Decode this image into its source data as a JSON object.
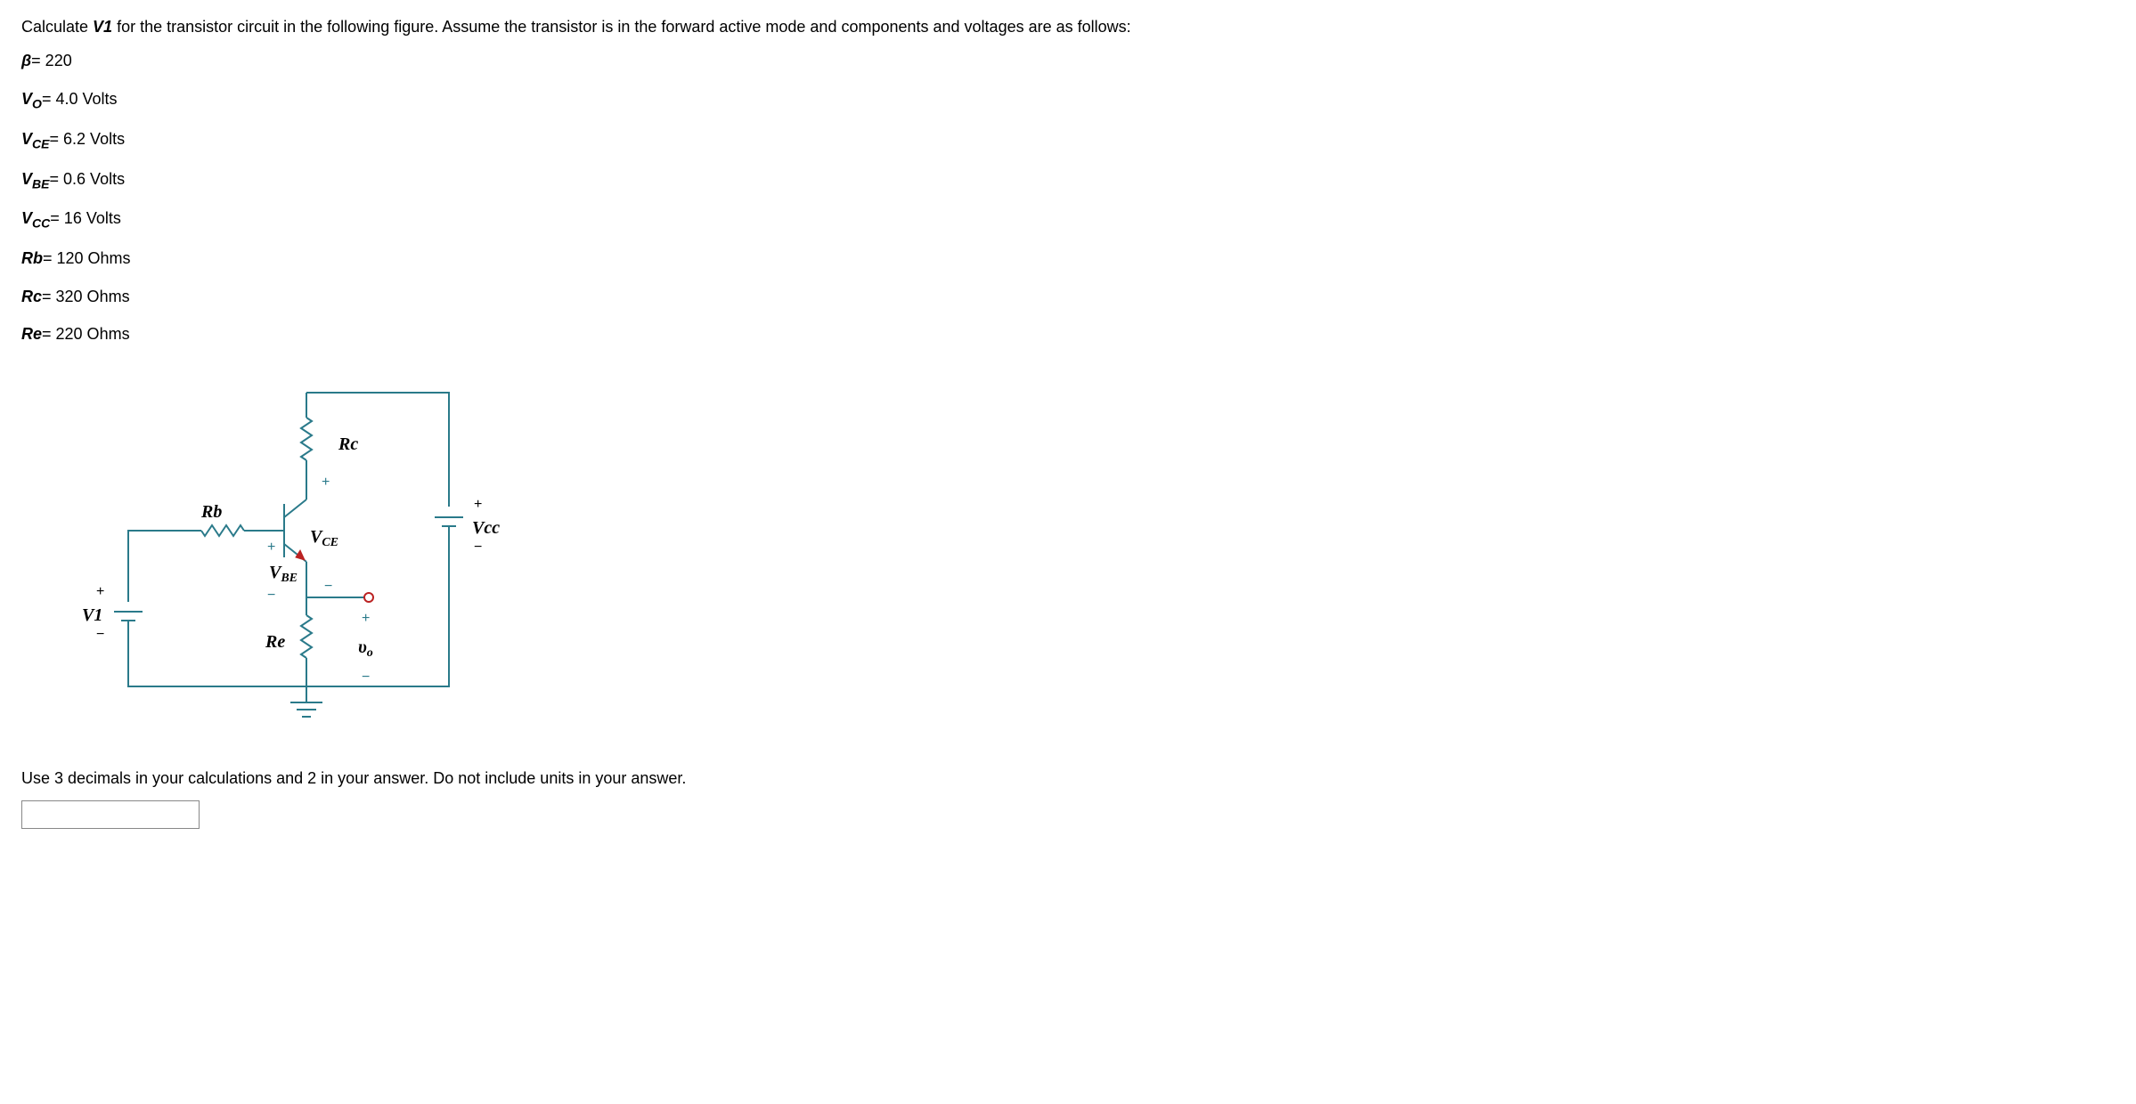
{
  "intro": "Calculate ",
  "target_var": "V1",
  "intro_rest": " for the transistor circuit in the following figure. Assume the transistor is in the forward active mode and components and voltages are as follows:",
  "params": {
    "beta": {
      "sym": "β",
      "val": "= 220"
    },
    "vo": {
      "sym": "V",
      "sub": "O",
      "val": "= 4.0 Volts"
    },
    "vce": {
      "sym": "V",
      "sub": "CE",
      "val": "= 6.2 Volts"
    },
    "vbe": {
      "sym": "V",
      "sub": "BE",
      "val": "= 0.6 Volts"
    },
    "vcc": {
      "sym": "V",
      "sub": "CC",
      "val": "= 16 Volts"
    },
    "rb": {
      "sym": "Rb",
      "val": "= 120 Ohms"
    },
    "rc": {
      "sym": "Rc",
      "val": "= 320 Ohms"
    },
    "re": {
      "sym": "Re",
      "val": "= 220 Ohms"
    }
  },
  "diagram": {
    "labels": {
      "Rb": "Rb",
      "Rc": "Rc",
      "Re": "Re",
      "VCE": "V",
      "VCE_sub": "CE",
      "VBE": "V",
      "VBE_sub": "BE",
      "V1": "V1",
      "Vcc": "Vcc",
      "vo_node": "υ",
      "vo_sub": "o"
    }
  },
  "instruction": "Use 3 decimals in your calculations and 2 in your answer. Do not include units in your answer.",
  "answer_value": ""
}
